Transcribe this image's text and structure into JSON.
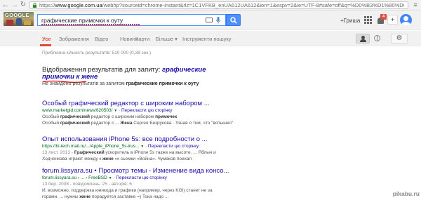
{
  "browser": {
    "url_scheme": "https://",
    "url_host": "www.google.com.ua",
    "url_path": "/webhp?sourceid=chrome-instant&rlz=1C1VFKB_enUA612UA612&ion=1&espv=2&ie=UTF-8#safe=off&q=%D0%B3%D1%80%D0%B0%D1%"
  },
  "header": {
    "logo_text": "GOOGLE",
    "query": "графические примочки к оуту",
    "user_name": "+Гриша",
    "notification_count": "4",
    "share_label": "+"
  },
  "tabs": {
    "all": "Усе",
    "images": "Зображення",
    "video": "Відео",
    "news": "Новини",
    "maps": "Карти",
    "more": "Більше ▾",
    "tools": "Інструменти пошуку"
  },
  "results": {
    "stats": "Приблизна кількість результатів: 510 000 (0,38 сек.)",
    "spell": {
      "prefix": "Відображення результатів для запиту: ",
      "corrected_line1": "графические",
      "corrected_line2": "примочки к жене",
      "not_found_prefix": "Не знайдено результатів за запитом ",
      "original_query": "графические примочки к оуту"
    },
    "items": [
      {
        "title": "Особый графический редактор с широким набором ...",
        "url": "www.marketgid.com/news/620503/",
        "translate": "Перекласти цю сторінку",
        "snippet1_a": "Особый ",
        "snippet1_b": "графический",
        "snippet1_c": " редактор с широким набором ",
        "snippet1_d": "примочек",
        "snippet2_a": "Особый ",
        "snippet2_b": "графический",
        "snippet2_c": " редактор с ... ",
        "snippet2_d": "Жена",
        "snippet2_e": " Сергея Безрукова · Узнав о том, что \"вспышко\""
      },
      {
        "title": "Опыт использования iPhone 5s: все подробности о ...",
        "url": "https://hi-tech.mail.ru/.../Apple_iPhone_5s-irus...",
        "translate": "Перекласти цю сторінку",
        "date": "13 лист. 2013 - ",
        "snippet1_b": "Графический",
        "snippet1_c": " ускоритель в iPhone 5s также на высоте. ... Яблыч и",
        "snippet2_a": "Ходченкова играют между к ",
        "snippet2_b": "жене",
        "snippet2_c": " «к сьемки «Война». Чумаков поехал"
      },
      {
        "title": "forum.lissyara.su • Просмотр темы - Изменение вида консо...",
        "url": "forum.lissyara.su › ... › FreeBSD",
        "translate": "Перекласти цю сторінку",
        "date": "13 бер. 2008 - повідомлень: 25 - авторів: 6",
        "snippet1": "И, возможно, поддержка юникода и графики (например, через KGI) станет не за",
        "snippet2_a": "горами. ... нужны ",
        "snippet2_b": "жене",
        "snippet2_c": " порадуется заставке =) Тока надо ..."
      }
    ]
  },
  "watermark": "pikabu.ru"
}
